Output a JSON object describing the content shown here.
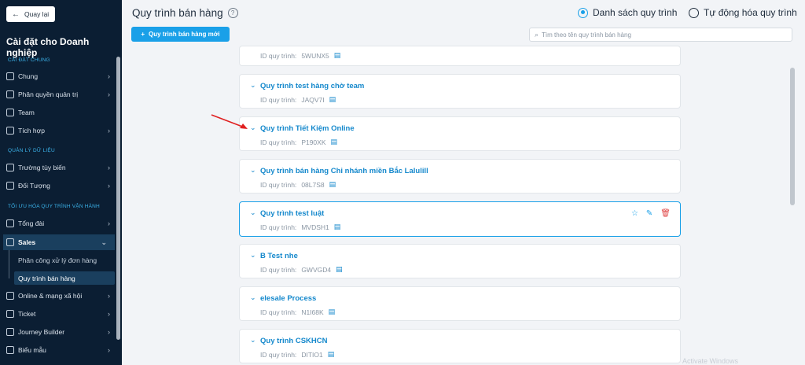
{
  "sidebar": {
    "back_label": "Quay lại",
    "title": "Cài đặt cho Doanh nghiệp",
    "sections": {
      "general": "CÀI ĐẶT CHUNG",
      "data": "QUẢN LÝ DỮ LIỆU",
      "optimize": "TỐI ƯU HÓA QUY TRÌNH VẬN HÀNH"
    },
    "items": {
      "chung": "Chung",
      "phan_quyen": "Phân quyền quản trị",
      "team": "Team",
      "tich_hop": "Tích hợp",
      "truong_tuy_bien": "Trường tùy biến",
      "doi_tuong": "Đối Tượng",
      "tong_dai": "Tổng đài",
      "sales": "Sales",
      "sub_phan_cong": "Phân công xử lý đơn hàng",
      "sub_quy_trinh": "Quy trình bán hàng",
      "online": "Online & mạng xã hội",
      "ticket": "Ticket",
      "journey": "Journey Builder",
      "bieu_mau": "Biểu mẫu"
    }
  },
  "header": {
    "title": "Quy trình bán hàng",
    "new_button": "Quy trình bán hàng mới",
    "radio_list": "Danh sách quy trình",
    "radio_auto": "Tự động hóa quy trình",
    "search_placeholder": "Tìm theo tên quy trình bán hàng"
  },
  "list": {
    "id_prefix": "ID quy trình:",
    "items": [
      {
        "name": "",
        "id": "5WUNX5"
      },
      {
        "name": "Quy trình test hàng chờ team",
        "id": "JAQV7I"
      },
      {
        "name": "Quy trình Tiết Kiệm Online",
        "id": "P190XK"
      },
      {
        "name": "Quy trình bán hàng Chi nhánh miền Bắc Lalulill",
        "id": "08L7S8"
      },
      {
        "name": "Quy trình test luật",
        "id": "MVDSH1"
      },
      {
        "name": "B Test nhe",
        "id": "GWVGD4"
      },
      {
        "name": "elesale Process",
        "id": "N1I68K"
      },
      {
        "name": "Quy trình CSKHCN",
        "id": "DITIO1"
      }
    ]
  },
  "watermark": "Activate Windows",
  "colors": {
    "accent": "#1aa0e8",
    "sidebar": "#0b1e33",
    "danger": "#e04848"
  }
}
